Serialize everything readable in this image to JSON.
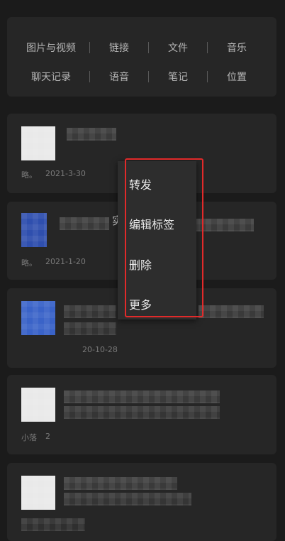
{
  "filters": {
    "row1": [
      "图片与视频",
      "链接",
      "文件",
      "音乐"
    ],
    "row2": [
      "聊天记录",
      "语音",
      "笔记",
      "位置"
    ]
  },
  "items": [
    {
      "source": "略。",
      "date": "2021-3-30"
    },
    {
      "source": "略。",
      "date": "2021-1-20",
      "title_fragment": "实"
    },
    {
      "source": "",
      "date": "20-10-28"
    },
    {
      "source": "小落",
      "date": "2"
    },
    {
      "source": "",
      "date": ""
    }
  ],
  "context_menu": {
    "items": [
      "转发",
      "编辑标签",
      "删除",
      "更多"
    ]
  },
  "colors": {
    "background": "#1b1b1b",
    "card": "#262626",
    "menu": "#2d2d2d",
    "highlight": "#e12a2a",
    "thumb_blue": "#3a63c8"
  }
}
